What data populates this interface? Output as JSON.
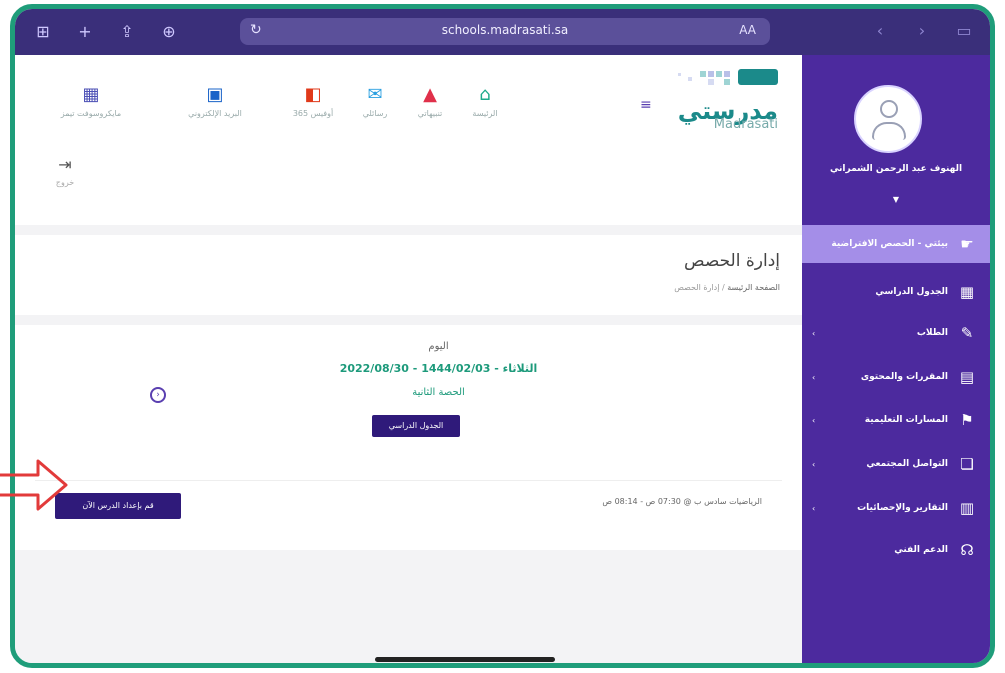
{
  "browser": {
    "url": "schools.madrasati.sa",
    "reader_label": "AA"
  },
  "brand": {
    "logo_text": "مدرستي",
    "logo_sub": "Madrasati"
  },
  "top_nav": {
    "items": [
      {
        "label": "الرئيسة",
        "icon": "home-icon"
      },
      {
        "label": "تنبيهاتي",
        "icon": "bell-icon"
      },
      {
        "label": "رسائلي",
        "icon": "mail-icon"
      },
      {
        "label": "أوفيس 365",
        "icon": "office-icon"
      },
      {
        "label": "البريد الإلكتروني",
        "icon": "outlook-icon"
      },
      {
        "label": "مايكروسوفت تيمز",
        "icon": "teams-icon"
      }
    ],
    "logout_label": "خروج"
  },
  "user": {
    "name": "الهنوف عبد الرحمن الشمراني"
  },
  "sidebar": {
    "items": [
      {
        "label": "بيئتي - الحصص الافتراضية",
        "icon": "pointer-icon"
      },
      {
        "label": "الجدول الدراسي",
        "icon": "calendar-icon"
      },
      {
        "label": "الطلاب",
        "icon": "students-icon"
      },
      {
        "label": "المقررات والمحتوى",
        "icon": "content-icon"
      },
      {
        "label": "المسارات التعليمية",
        "icon": "tracks-icon"
      },
      {
        "label": "التواصل المجتمعي",
        "icon": "chat-icon"
      },
      {
        "label": "التقارير والإحصائيات",
        "icon": "reports-icon"
      },
      {
        "label": "الدعم الفني",
        "icon": "support-icon"
      }
    ]
  },
  "page": {
    "title": "إدارة الحصص",
    "breadcrumb_home": "الصفحة الرئيسة",
    "breadcrumb_current": "إدارة الحصص"
  },
  "today": {
    "label": "اليوم",
    "date_line": "الثلاثاء - 1444/02/03 - 2022/08/30",
    "period": "الحصة الثانية",
    "schedule_button": "الجدول الدراسي"
  },
  "lesson": {
    "info": "الرياضيات سادس ب @ 07:30 ص - 08:14 ص",
    "prepare_button": "قم بإعداد الدرس الآن"
  },
  "colors": {
    "sidebar": "#4c2a9e",
    "safari_bar": "#3a2f7a",
    "accent_green": "#1d9a7b",
    "button_dark": "#2f1a7a",
    "frame": "#1f9d7a"
  }
}
